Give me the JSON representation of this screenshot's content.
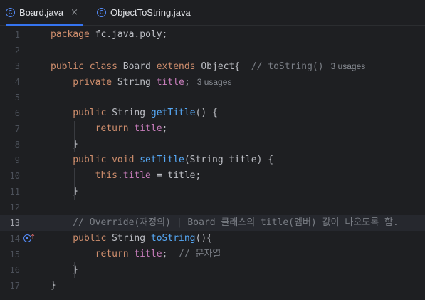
{
  "tabs": [
    {
      "label": "Board.java",
      "icon": "class-icon",
      "close": "×"
    },
    {
      "label": "ObjectToString.java",
      "icon": "class-icon"
    }
  ],
  "editor": {
    "lines": [
      {
        "num": "1",
        "tokens": [
          {
            "t": "package ",
            "c": "kw"
          },
          {
            "t": "fc.java.poly;",
            "c": "pl"
          }
        ]
      },
      {
        "num": "2",
        "tokens": []
      },
      {
        "num": "3",
        "tokens": [
          {
            "t": "public class ",
            "c": "kw"
          },
          {
            "t": "Board ",
            "c": "pl"
          },
          {
            "t": "extends ",
            "c": "kw"
          },
          {
            "t": "Object{  ",
            "c": "pl"
          },
          {
            "t": "// toString()",
            "c": "cm"
          }
        ],
        "hint": "3 usages"
      },
      {
        "num": "4",
        "tokens": [
          {
            "t": "    private ",
            "c": "kw"
          },
          {
            "t": "String ",
            "c": "pl"
          },
          {
            "t": "title",
            "c": "fld"
          },
          {
            "t": ";",
            "c": "pl"
          }
        ],
        "hint": "3 usages"
      },
      {
        "num": "5",
        "tokens": []
      },
      {
        "num": "6",
        "tokens": [
          {
            "t": "    public ",
            "c": "kw"
          },
          {
            "t": "String ",
            "c": "pl"
          },
          {
            "t": "getTitle",
            "c": "fn"
          },
          {
            "t": "() {",
            "c": "pl"
          }
        ]
      },
      {
        "num": "7",
        "tokens": [
          {
            "t": "        return ",
            "c": "kw"
          },
          {
            "t": "title",
            "c": "fld"
          },
          {
            "t": ";",
            "c": "pl"
          }
        ]
      },
      {
        "num": "8",
        "tokens": [
          {
            "t": "    }",
            "c": "pl"
          }
        ]
      },
      {
        "num": "9",
        "tokens": [
          {
            "t": "    public void ",
            "c": "kw"
          },
          {
            "t": "setTitle",
            "c": "fn"
          },
          {
            "t": "(String title) {",
            "c": "pl"
          }
        ]
      },
      {
        "num": "10",
        "tokens": [
          {
            "t": "        this",
            "c": "kw"
          },
          {
            "t": ".",
            "c": "pl"
          },
          {
            "t": "title",
            "c": "fld"
          },
          {
            "t": " = title;",
            "c": "pl"
          }
        ]
      },
      {
        "num": "11",
        "tokens": [
          {
            "t": "    }",
            "c": "pl"
          }
        ]
      },
      {
        "num": "12",
        "tokens": []
      },
      {
        "num": "13",
        "current": true,
        "tokens": [
          {
            "t": "    // Override(재정의) | Board 클래스의 title(멤버) 값이 나오도록 함.",
            "c": "cm"
          }
        ]
      },
      {
        "num": "14",
        "override": true,
        "tokens": [
          {
            "t": "    public ",
            "c": "kw"
          },
          {
            "t": "String ",
            "c": "pl"
          },
          {
            "t": "toString",
            "c": "fn"
          },
          {
            "t": "(){",
            "c": "pl"
          }
        ]
      },
      {
        "num": "15",
        "tokens": [
          {
            "t": "        return ",
            "c": "kw"
          },
          {
            "t": "title",
            "c": "fld"
          },
          {
            "t": ";  ",
            "c": "pl"
          },
          {
            "t": "// 문자열",
            "c": "cm"
          }
        ]
      },
      {
        "num": "16",
        "tokens": [
          {
            "t": "    }",
            "c": "pl"
          }
        ]
      },
      {
        "num": "17",
        "tokens": [
          {
            "t": "}",
            "c": "pl"
          }
        ]
      }
    ]
  }
}
